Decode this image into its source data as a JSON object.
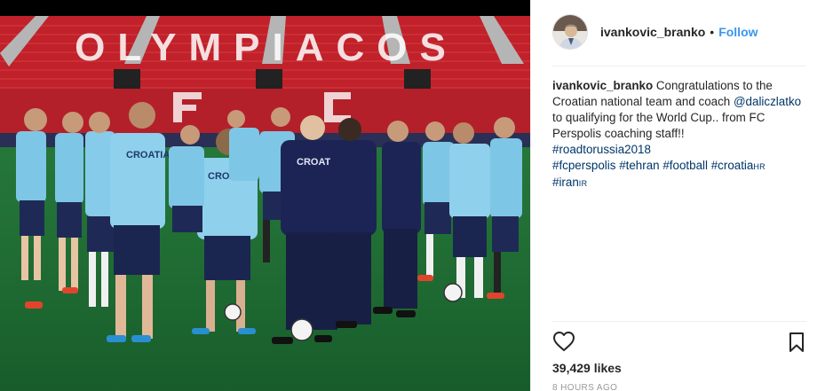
{
  "post": {
    "photo": {
      "stadium_letters": "OLYMPIACOS",
      "shirt_text": "CROATIA",
      "coach_text": "CROATIA"
    },
    "author": {
      "username": "ivankovic_branko",
      "separator": "•",
      "follow_label": "Follow",
      "avatar_icon": "profile-avatar"
    },
    "caption": {
      "username": "ivankovic_branko",
      "text_1": " Congratulations to the Croatian national team and coach ",
      "mention": "@daliczlatko",
      "text_2": " to qualifying for the World Cup.. from FC Perspolis coaching staff!!",
      "tags_line1": [
        "#roadtorussia2018"
      ],
      "tags_line2": [
        "#fcperspolis",
        "#tehran",
        "#football",
        "#croatia"
      ],
      "tag_flag_hr": "HR",
      "tags_line3": [
        "#iran"
      ],
      "tag_flag_ir": "IR"
    },
    "actions": {
      "like_icon": "heart-outline-icon",
      "save_icon": "bookmark-outline-icon"
    },
    "likes": "39,429 likes",
    "time_ago": "8 HOURS AGO"
  }
}
